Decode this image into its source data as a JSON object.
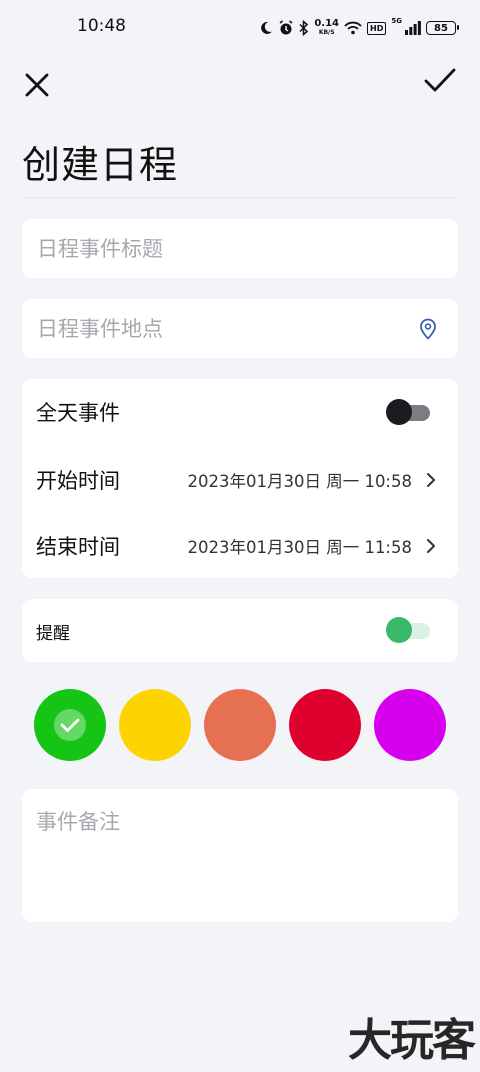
{
  "status_bar": {
    "time": "10:48",
    "net_speed_value": "0.14",
    "net_speed_unit": "KB/S",
    "hd_label": "HD",
    "signal_label": "5G",
    "battery_level": "85",
    "icons": [
      "moon-icon",
      "alarm-icon",
      "bluetooth-icon",
      "wifi-icon",
      "signal-icon",
      "battery-icon"
    ]
  },
  "header": {
    "close_icon": "close-icon",
    "confirm_icon": "check-icon",
    "title": "创建日程"
  },
  "form": {
    "title_placeholder": "日程事件标题",
    "location_placeholder": "日程事件地点",
    "location_icon": "location-pin-icon",
    "all_day_label": "全天事件",
    "all_day_enabled": false,
    "start_label": "开始时间",
    "start_value": "2023年01月30日 周一 10:58",
    "end_label": "结束时间",
    "end_value": "2023年01月30日 周一 11:58",
    "reminder_label": "提醒",
    "reminder_enabled": true,
    "notes_placeholder": "事件备注"
  },
  "colors": {
    "selected_index": 0,
    "options": [
      "#15c414",
      "#fdd300",
      "#e57052",
      "#e0002f",
      "#d600ef"
    ],
    "toggle_off_track": "#7d7c82",
    "toggle_off_knob": "#1c1b20",
    "toggle_on_track": "#d9f2e1",
    "toggle_on_knob": "#3ab86a",
    "location_icon": "#3a5fb0"
  },
  "watermark": "大玩客"
}
